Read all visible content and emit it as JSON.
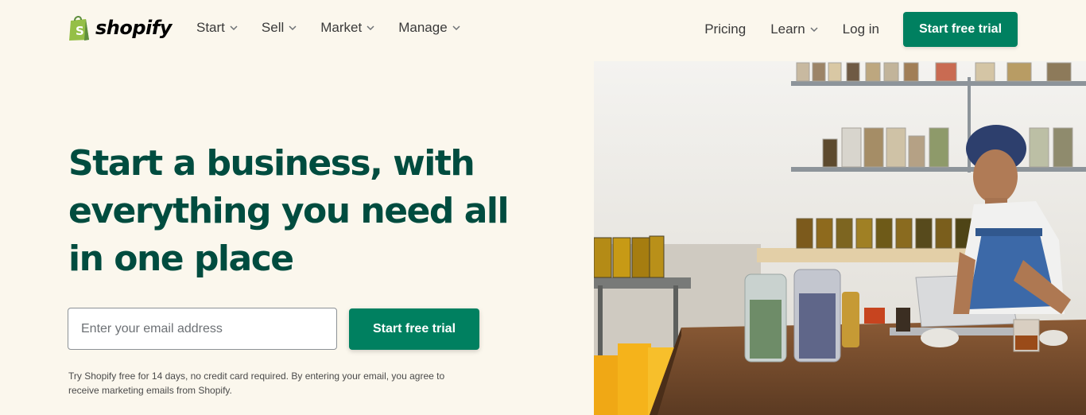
{
  "brand": {
    "name": "shopify"
  },
  "nav": {
    "left": [
      {
        "label": "Start"
      },
      {
        "label": "Sell"
      },
      {
        "label": "Market"
      },
      {
        "label": "Manage"
      }
    ],
    "pricing": "Pricing",
    "learn": "Learn",
    "login": "Log in",
    "cta": "Start free trial"
  },
  "hero": {
    "title": "Start a business, with everything you need all in one place",
    "email_placeholder": "Enter your email address",
    "cta": "Start free trial",
    "disclaimer": "Try Shopify free for 14 days, no credit card required. By entering your email, you agree to receive marketing emails from Shopify."
  },
  "colors": {
    "background": "#fbf7ed",
    "brand_green": "#008060",
    "heading_green": "#004c3f"
  }
}
